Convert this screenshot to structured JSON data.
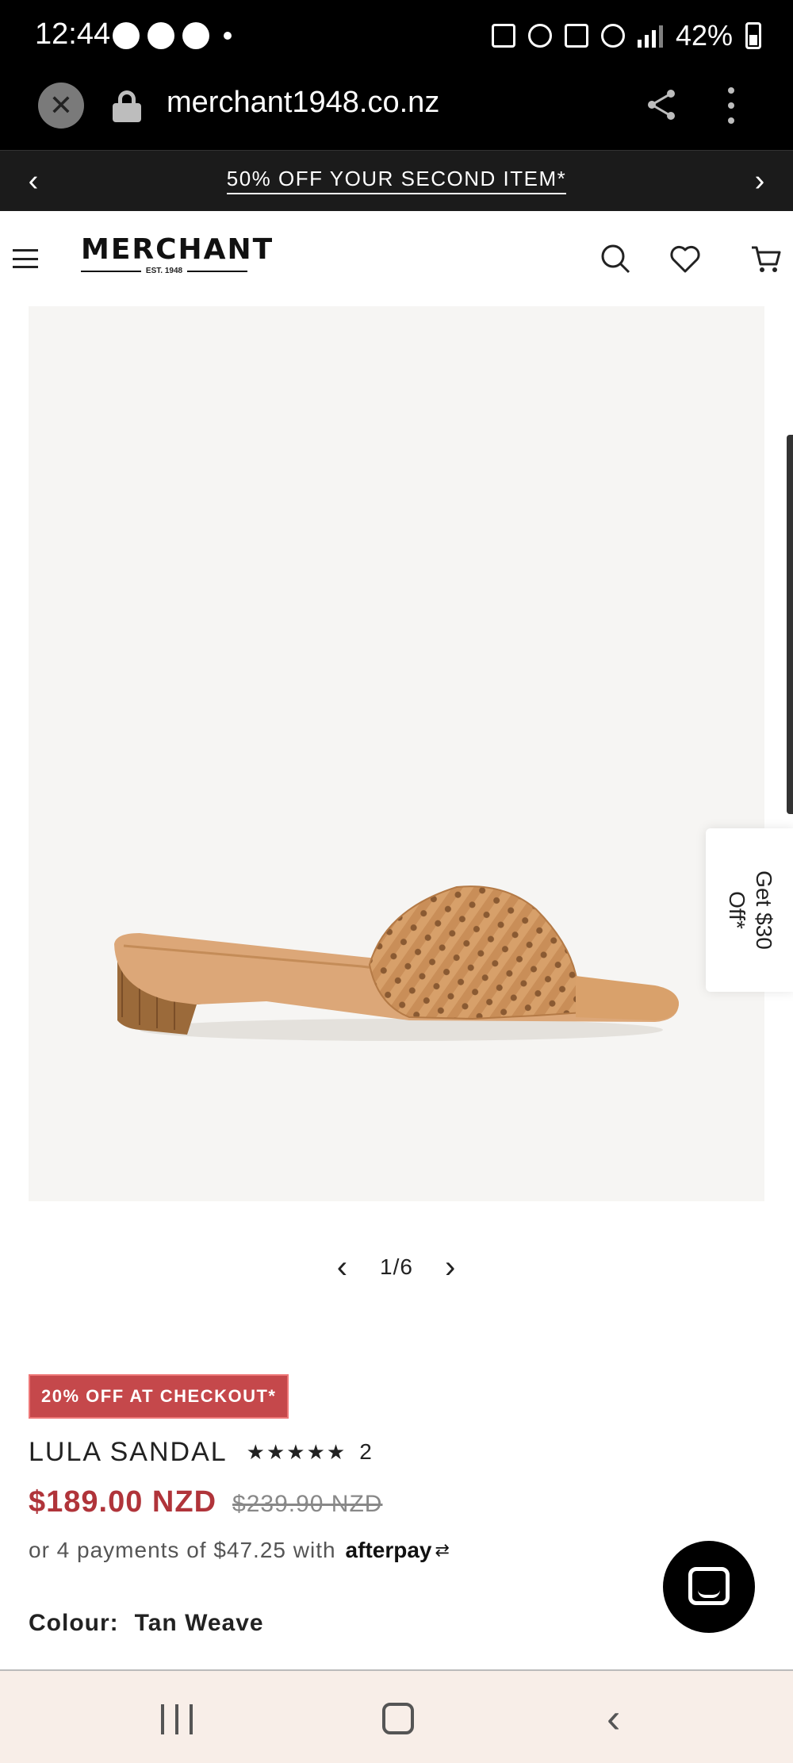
{
  "status_bar": {
    "time": "12:44",
    "battery": "42%",
    "notification_icons": [
      "messenger-icon",
      "chat-icon",
      "messenger-icon",
      "dot-icon"
    ]
  },
  "browser": {
    "url": "merchant1948.co.nz"
  },
  "promo": {
    "text": "50% OFF YOUR SECOND ITEM*"
  },
  "site": {
    "logo_word": "MERCHANT",
    "logo_est": "EST. 1948"
  },
  "gallery": {
    "counter": "1/6"
  },
  "side_tab": {
    "label": "Get $30 Off*"
  },
  "product": {
    "badge": "20% OFF AT CHECKOUT*",
    "name": "LULA SANDAL",
    "rating": 5,
    "review_count": "2",
    "price_sale": "$189.00 NZD",
    "price_original": "$239.90 NZD",
    "afterpay_text": "or 4 payments of $47.25 with",
    "afterpay_brand": "afterpay",
    "colour_label": "Colour:",
    "colour_value": "Tan Weave"
  },
  "colors": {
    "promo_bg": "#1b1b1b",
    "badge_bg": "#c5484b",
    "sale_price": "#b0343a",
    "image_bg": "#f6f5f3",
    "nav_bg": "#f8eee8"
  }
}
